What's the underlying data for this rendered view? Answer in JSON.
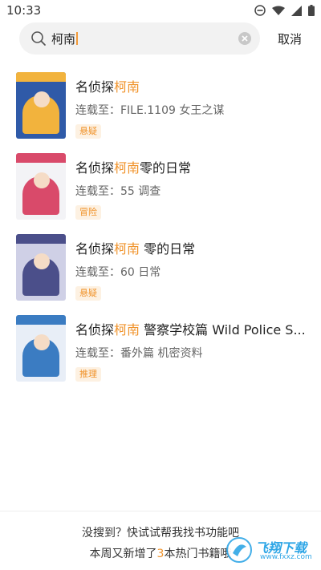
{
  "status_bar": {
    "time": "10:33",
    "icons": [
      "do-not-disturb-icon",
      "wifi-icon",
      "signal-icon",
      "battery-icon"
    ]
  },
  "search": {
    "query": "柯南",
    "cancel_label": "取消"
  },
  "results": [
    {
      "title_prefix": "名侦探",
      "title_highlight": "柯南",
      "title_suffix": "",
      "subtitle": "连载至：FILE.1109 女王之谋",
      "tag": "悬疑",
      "cover_colors": [
        "#f2b33d",
        "#2f5aa8"
      ]
    },
    {
      "title_prefix": "名侦探",
      "title_highlight": "柯南",
      "title_suffix": "零的日常",
      "subtitle": "连载至：55 调查",
      "tag": "冒险",
      "cover_colors": [
        "#d94a6a",
        "#f3f3f6"
      ]
    },
    {
      "title_prefix": "名侦探",
      "title_highlight": "柯南",
      "title_suffix": " 零的日常",
      "subtitle": "连载至：60 日常",
      "tag": "悬疑",
      "cover_colors": [
        "#4b4f8a",
        "#cfd0e6"
      ]
    },
    {
      "title_prefix": "名侦探",
      "title_highlight": "柯南",
      "title_suffix": " 警察学校篇 Wild Police S...",
      "subtitle": "连载至：番外篇 机密资料",
      "tag": "推理",
      "cover_colors": [
        "#3b7cc2",
        "#e8eef7"
      ]
    }
  ],
  "footer": {
    "line1": "没搜到？快试试帮我找书功能吧",
    "line2_prefix": "本周又新增了",
    "line2_number": "3",
    "line2_suffix": "本热门书籍哦"
  },
  "watermark": {
    "text": "飞翔下载",
    "url": "www.fxxz.com"
  },
  "colors": {
    "accent": "#f0932b",
    "tag_bg": "#fdf1e2",
    "search_bg": "#f2f2f2"
  }
}
